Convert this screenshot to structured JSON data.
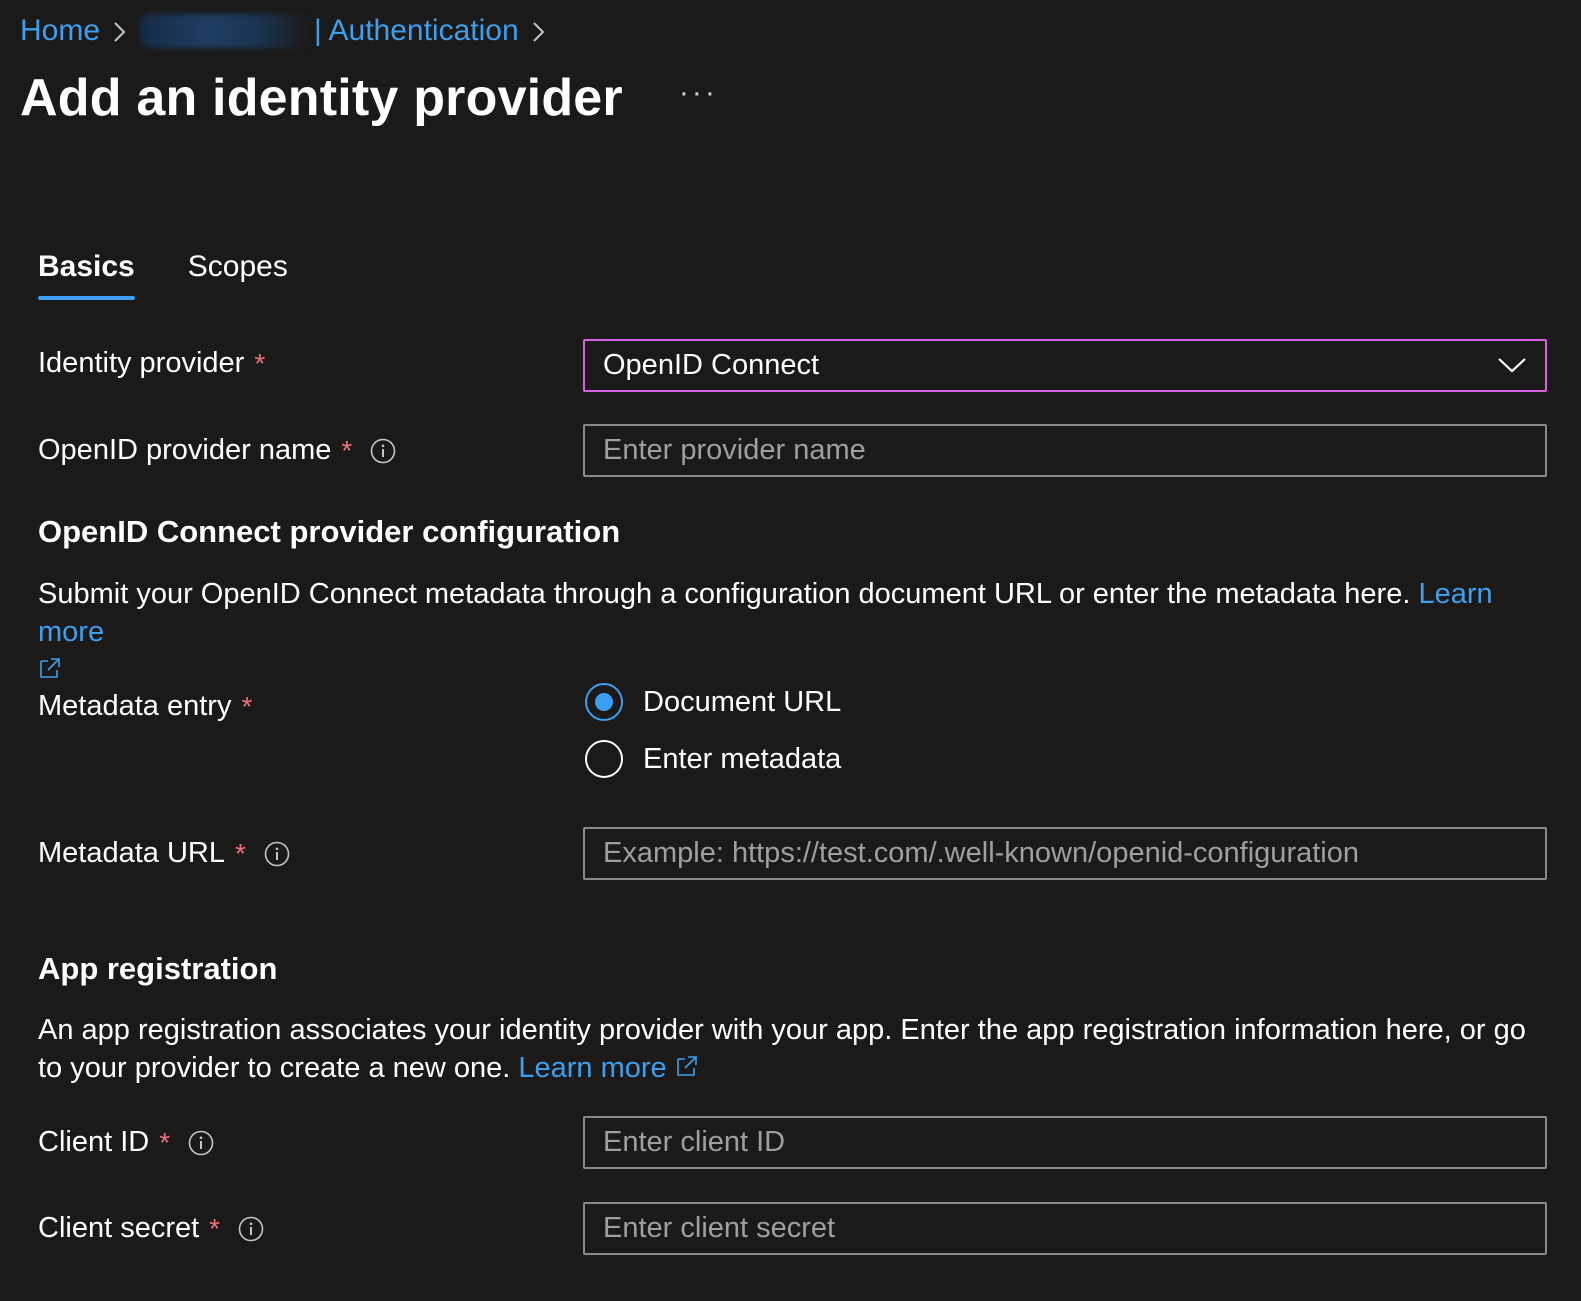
{
  "breadcrumb": {
    "home": "Home",
    "authentication": "| Authentication"
  },
  "page": {
    "title": "Add an identity provider",
    "more": "···"
  },
  "tabs": [
    {
      "label": "Basics",
      "active": true
    },
    {
      "label": "Scopes",
      "active": false
    }
  ],
  "identity_provider": {
    "label": "Identity provider",
    "required": "*",
    "value": "OpenID Connect"
  },
  "provider_name": {
    "label": "OpenID provider name",
    "required": "*",
    "placeholder": "Enter provider name"
  },
  "config_section": {
    "heading": "OpenID Connect provider configuration",
    "description": "Submit your OpenID Connect metadata through a configuration document URL or enter the metadata here.",
    "learn_more": "Learn more"
  },
  "metadata_entry": {
    "label": "Metadata entry",
    "required": "*",
    "options": [
      {
        "label": "Document URL",
        "selected": true
      },
      {
        "label": "Enter metadata",
        "selected": false
      }
    ]
  },
  "metadata_url": {
    "label": "Metadata URL",
    "required": "*",
    "placeholder": "Example: https://test.com/.well-known/openid-configuration"
  },
  "app_registration": {
    "heading": "App registration",
    "description": "An app registration associates your identity provider with your app. Enter the app registration information here, or go to your provider to create a new one.",
    "learn_more": "Learn more"
  },
  "client_id": {
    "label": "Client ID",
    "required": "*",
    "placeholder": "Enter client ID"
  },
  "client_secret": {
    "label": "Client secret",
    "required": "*",
    "placeholder": "Enter client secret"
  },
  "colors": {
    "background": "#1b1a19",
    "link": "#3c9ff0",
    "required": "#f1707b",
    "focus_border": "#d862e6",
    "input_border": "#8a8886"
  }
}
